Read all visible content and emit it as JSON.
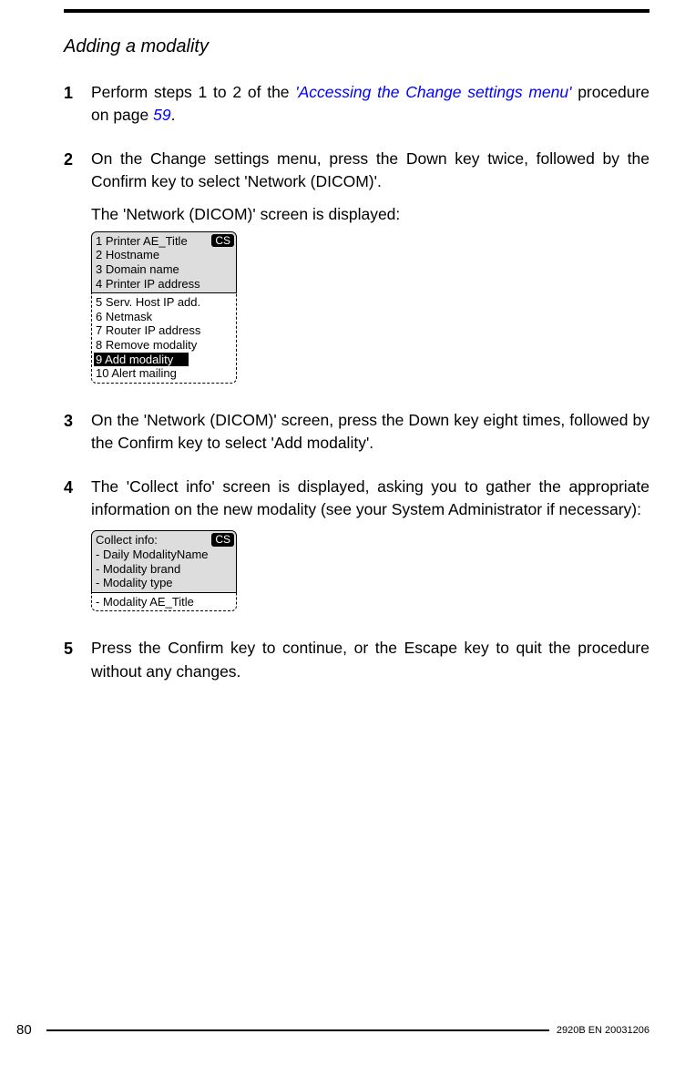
{
  "heading": "Adding a modality",
  "steps": {
    "1": {
      "num": "1",
      "pre": "Perform steps 1 to 2 of the ",
      "link": "'Accessing the Change settings menu'",
      "mid": " procedure on page ",
      "pageref": "59",
      "post": "."
    },
    "2": {
      "num": "2",
      "text": "On the Change settings menu, press the Down key twice, followed by the Confirm key to select 'Network (DICOM)'.",
      "sub": "The 'Network (DICOM)' screen is displayed:"
    },
    "3": {
      "num": "3",
      "text": "On the 'Network (DICOM)' screen, press the Down key eight times, followed by the Confirm key to select 'Add modality'."
    },
    "4": {
      "num": "4",
      "text": "The 'Collect info' screen is displayed, asking you to gather the appropriate information on the new modality (see your System Administrator if necessary):"
    },
    "5": {
      "num": "5",
      "text": "Press the Confirm key to continue, or the Escape key to quit the procedure without any changes."
    }
  },
  "screen1": {
    "badge": "CS",
    "top": [
      "1 Printer AE_Title",
      "2 Hostname",
      "3 Domain name",
      "4 Printer IP address"
    ],
    "rest_pre": [
      "5 Serv. Host IP add.",
      "6 Netmask",
      "7 Router IP address",
      "8 Remove modality"
    ],
    "selected": "9 Add modality",
    "rest_post": [
      "10 Alert mailing"
    ]
  },
  "screen2": {
    "badge": "CS",
    "top": [
      "Collect info:",
      "- Daily ModalityName",
      "- Modality brand",
      "- Modality type"
    ],
    "rest": [
      "- Modality AE_Title"
    ]
  },
  "footer": {
    "page": "80",
    "docid": "2920B EN 20031206"
  }
}
